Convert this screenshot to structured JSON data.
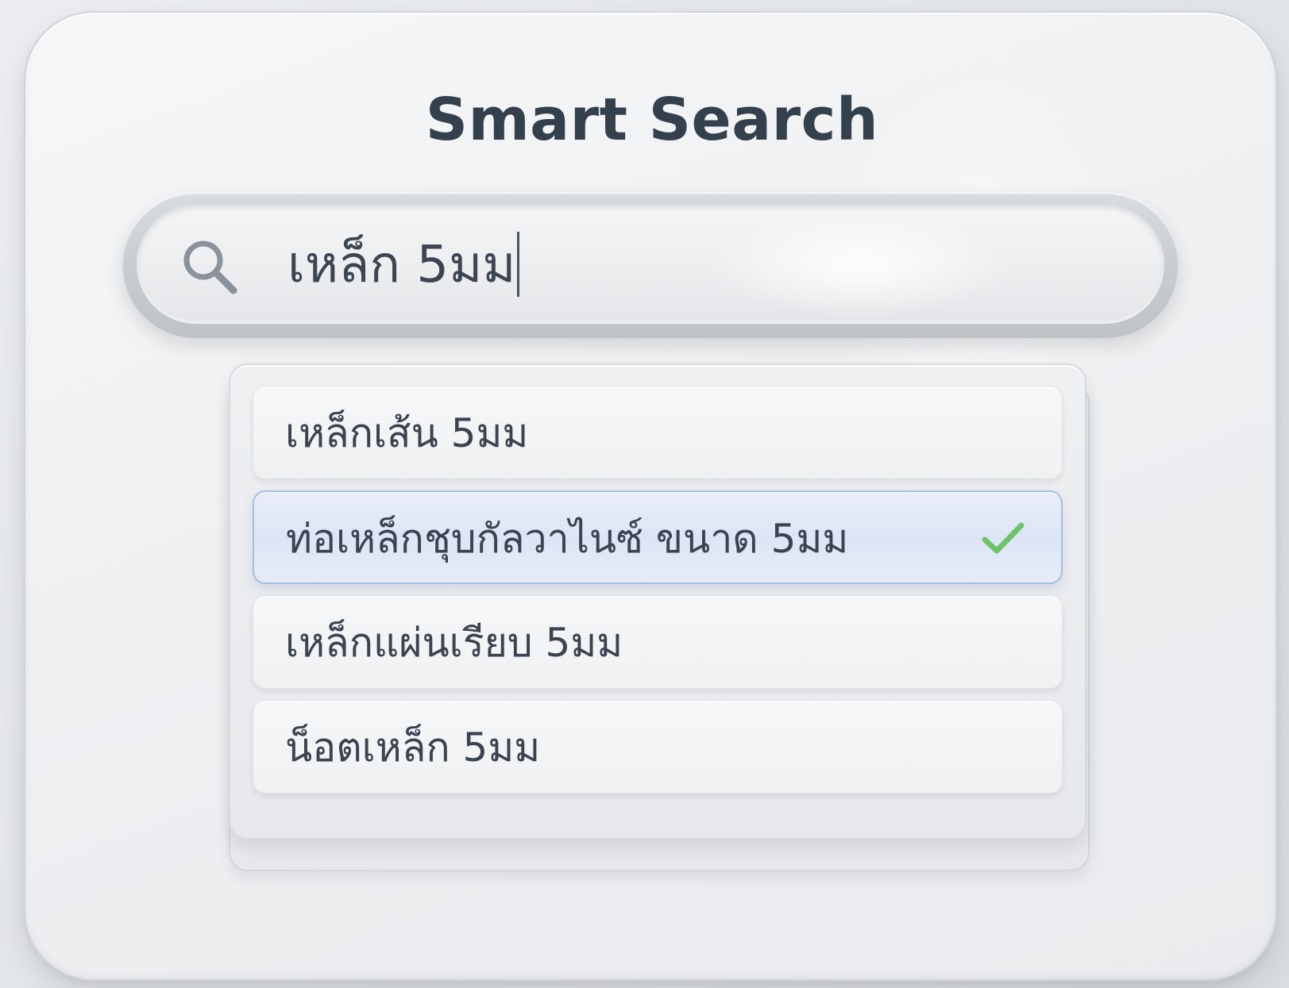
{
  "title": "Smart Search",
  "search": {
    "value": "เหล็ก 5มม",
    "icon": "search-icon"
  },
  "suggestions": [
    {
      "label": "เหล็กเส้น 5มม",
      "selected": false
    },
    {
      "label": "ท่อเหล็กชุบกัลวาไนซ์ ขนาด 5มม",
      "selected": true,
      "indicator": "check-icon"
    },
    {
      "label": "เหล็กแผ่นเรียบ 5มม",
      "selected": false
    },
    {
      "label": "น็อตเหล็ก 5มม",
      "selected": false
    }
  ],
  "colors": {
    "title": "#35404d",
    "text": "#3a4350",
    "selected_border": "#a9bde0",
    "check": "#6cc46a"
  }
}
